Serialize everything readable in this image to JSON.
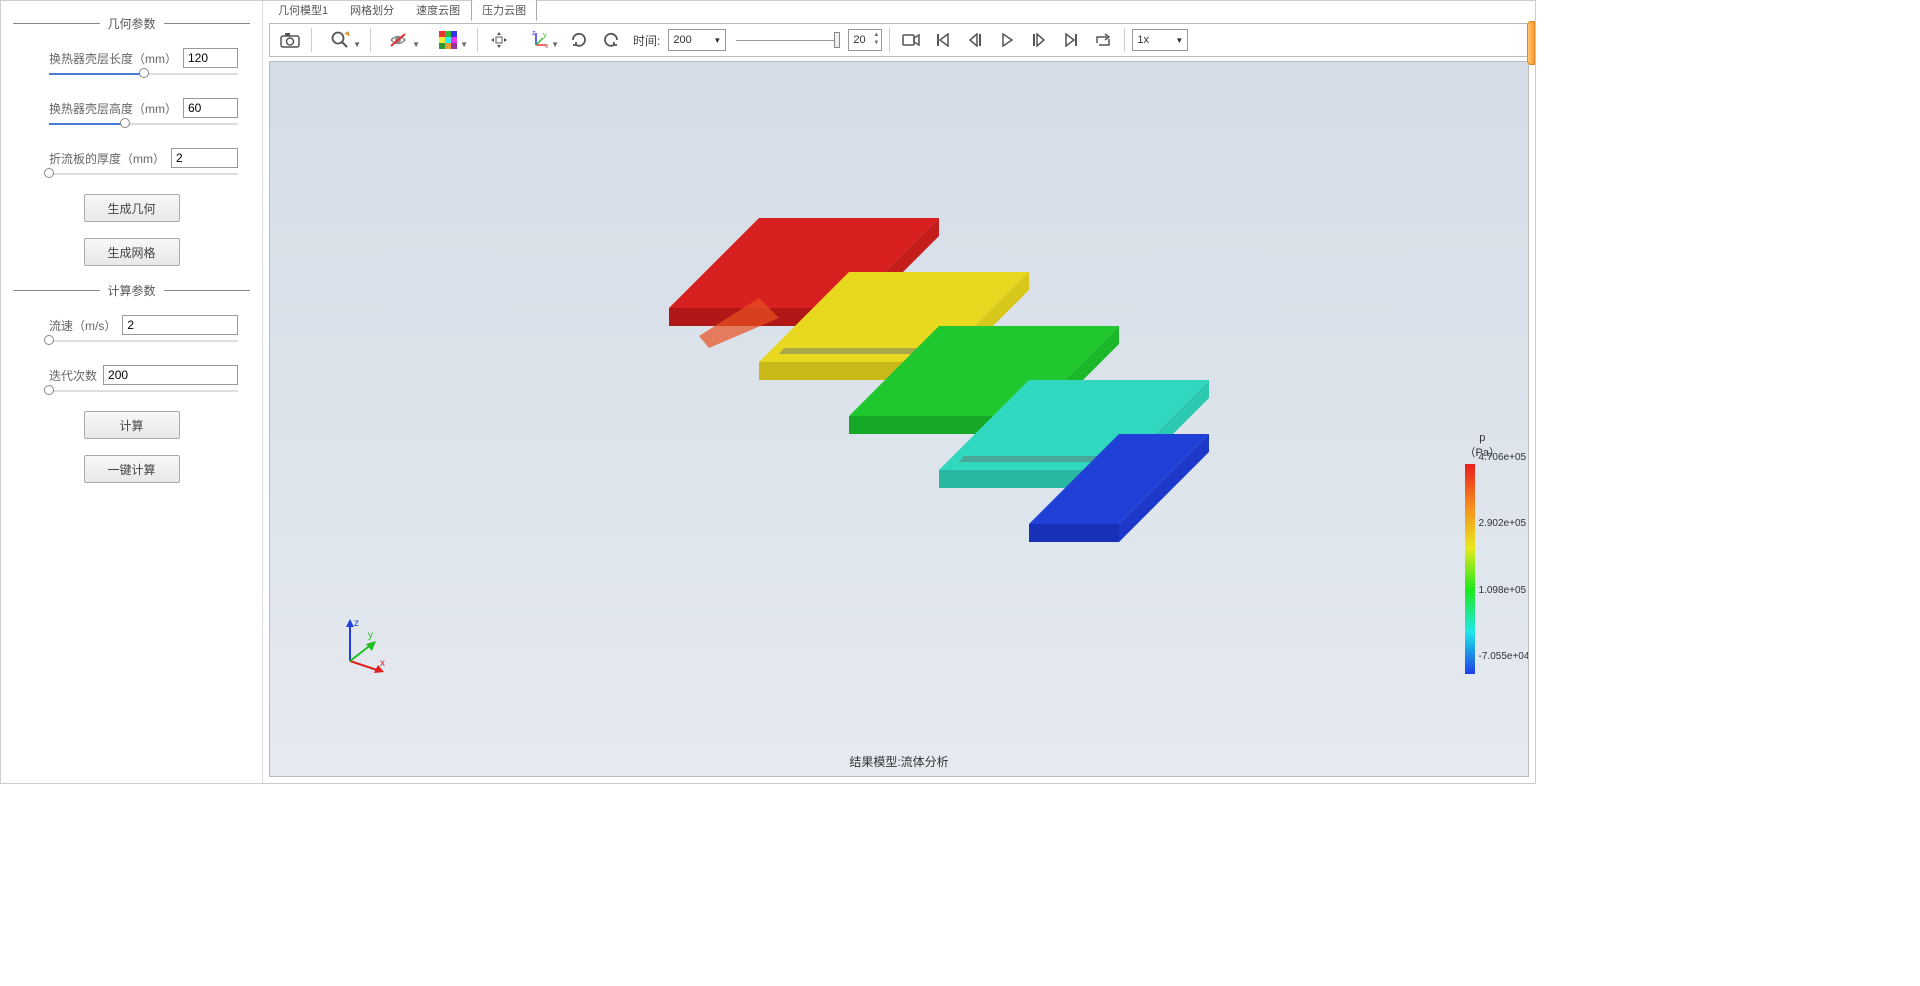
{
  "sidebar": {
    "geometry_header": "几何参数",
    "calc_header": "计算参数",
    "shell_length_label": "换热器壳层长度（mm）",
    "shell_length_value": "120",
    "shell_height_label": "换热器壳层高度（mm）",
    "shell_height_value": "60",
    "baffle_thickness_label": "折流板的厚度（mm）",
    "baffle_thickness_value": "2",
    "btn_gen_geo": "生成几何",
    "btn_gen_mesh": "生成网格",
    "velocity_label": "流速（m/s）",
    "velocity_value": "2",
    "iterations_label": "迭代次数",
    "iterations_value": "200",
    "btn_calc": "计算",
    "btn_one_click": "一键计算"
  },
  "tabs": {
    "items": [
      {
        "label": "几何模型1",
        "active": false
      },
      {
        "label": "网格划分",
        "active": false
      },
      {
        "label": "速度云图",
        "active": false
      },
      {
        "label": "压力云图",
        "active": true
      }
    ]
  },
  "toolbar": {
    "time_label": "时间:",
    "time_value": "200",
    "frame_value": "20",
    "speed_value": "1x"
  },
  "viewport": {
    "result_label": "结果模型:流体分析",
    "axes": {
      "x": "x",
      "y": "y",
      "z": "z"
    }
  },
  "colorbar": {
    "title_line1": "p",
    "title_line2": "（Pa）",
    "labels": [
      "4.706e+05",
      "2.902e+05",
      "1.098e+05",
      "-7.055e+04"
    ]
  }
}
